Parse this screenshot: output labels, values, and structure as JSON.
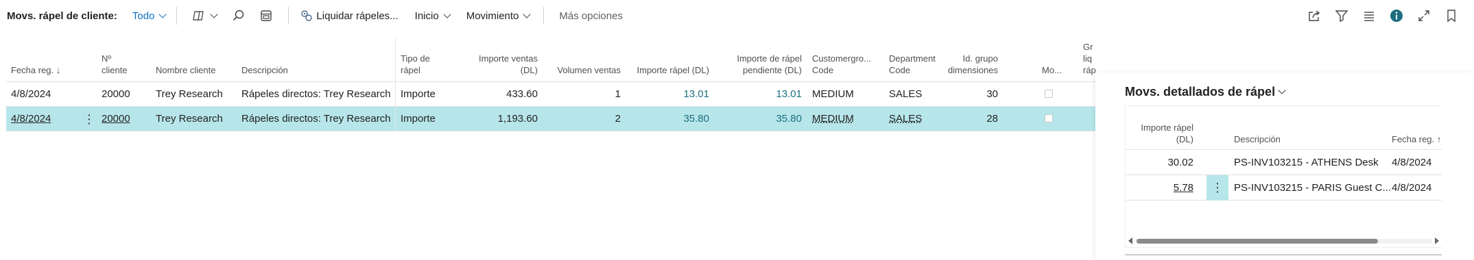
{
  "page": {
    "title": "Movs. rápel de cliente:",
    "filter": "Todo"
  },
  "actions": {
    "liquidar": "Liquidar rápeles...",
    "inicio": "Inicio",
    "movimiento": "Movimiento",
    "mas_opciones": "Más opciones"
  },
  "icons": {
    "copilot": "copilot-icon",
    "search": "search-icon",
    "edit_list": "edit-list-icon",
    "liquidar": "process-icon",
    "share": "share-icon",
    "filter": "filter-icon",
    "list_view": "list-view-icon",
    "info": "info-icon",
    "expand": "expand-icon",
    "bookmark": "bookmark-icon"
  },
  "colors": {
    "accent": "#106ebe",
    "selected_row": "#b7e6ea",
    "link_value": "#1c6e7e",
    "info_icon": "#1c6e7e"
  },
  "grid": {
    "headers": {
      "fecha": "Fecha reg.",
      "num_cliente_1": "Nº",
      "num_cliente_2": "cliente",
      "nombre": "Nombre cliente",
      "descripcion": "Descripción",
      "tipo_1": "Tipo de",
      "tipo_2": "rápel",
      "importe_ventas_1": "Importe ventas",
      "importe_ventas_2": "(DL)",
      "volumen": "Volumen ventas",
      "importe_rapel": "Importe rápel (DL)",
      "pendiente_1": "Importe de rápel",
      "pendiente_2": "pendiente (DL)",
      "customergroup_1": "Customergro...",
      "customergroup_2": "Code",
      "department_1": "Department",
      "department_2": "Code",
      "dim_1": "Id. grupo",
      "dim_2": "dimensiones",
      "mo": "Mo...",
      "overflow_1": "Gr",
      "overflow_2": "liq",
      "overflow_3": "ráp"
    },
    "rows": [
      {
        "fecha": "4/8/2024",
        "cliente": "20000",
        "nombre": "Trey Research",
        "descripcion": "Rápeles directos: Trey Research",
        "tipo": "Importe",
        "importe_ventas": "433.60",
        "volumen": "1",
        "importe_rapel": "13.01",
        "pendiente": "13.01",
        "customergroup": "MEDIUM",
        "department": "SALES",
        "dim": "30",
        "mo": false
      },
      {
        "fecha": "4/8/2024",
        "cliente": "20000",
        "nombre": "Trey Research",
        "descripcion": "Rápeles directos: Trey Research",
        "tipo": "Importe",
        "importe_ventas": "1,193.60",
        "volumen": "2",
        "importe_rapel": "35.80",
        "pendiente": "35.80",
        "customergroup": "MEDIUM",
        "department": "SALES",
        "dim": "28",
        "mo": false
      }
    ]
  },
  "factbox": {
    "title": "Movs. detallados de rápel",
    "headers": {
      "importe_1": "Importe rápel",
      "importe_2": "(DL)",
      "descripcion": "Descripción",
      "fecha": "Fecha reg."
    },
    "rows": [
      {
        "importe": "30.02",
        "descripcion": "PS-INV103215 - ATHENS Desk",
        "fecha": "4/8/2024"
      },
      {
        "importe": "5.78",
        "descripcion": "PS-INV103215 - PARIS Guest C...",
        "fecha": "4/8/2024"
      }
    ]
  }
}
